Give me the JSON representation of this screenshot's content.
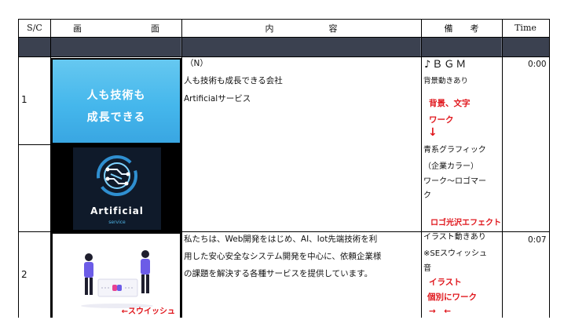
{
  "header": {
    "sc": "S/C",
    "screen_a": "画",
    "screen_b": "面",
    "content_a": "内",
    "content_b": "容",
    "remarks_a": "備",
    "remarks_b": "考",
    "time": "Time"
  },
  "rows": [
    {
      "num": "1",
      "time": "0:00",
      "thumb_text": [
        "人も技術も",
        "成長できる"
      ],
      "logo_word": "Artificial",
      "logo_sub": "service",
      "content": [
        "（N）",
        "人も技術も成長できる会社",
        "Artificialサービス"
      ],
      "remarks": [
        "♪ＢＧＭ",
        "背景動きあり"
      ],
      "remarks_red": [
        "背景、文字",
        "ワーク",
        "↓"
      ],
      "remarks2": [
        "青系グラフィック",
        "（企業カラー）",
        "ワーク～ロゴマー",
        "ク"
      ],
      "remarks2_red": "ロゴ光沢エフェクト"
    },
    {
      "num": "2",
      "time": "0:07",
      "thumb_caption": "←スウイッシュ",
      "content": [
        "私たちは、Web開発をはじめ、AI、Iot先端技術を利",
        "用した安心安全なシステム開発を中心に、依頼企業様",
        "の課題を解決する各種サービスを提供しています。"
      ],
      "remarks": [
        "イラスト動きあり",
        "※SEスウィッシュ",
        "音"
      ],
      "remarks_red": [
        "イラスト",
        "個別にワーク",
        "→　←"
      ]
    }
  ]
}
